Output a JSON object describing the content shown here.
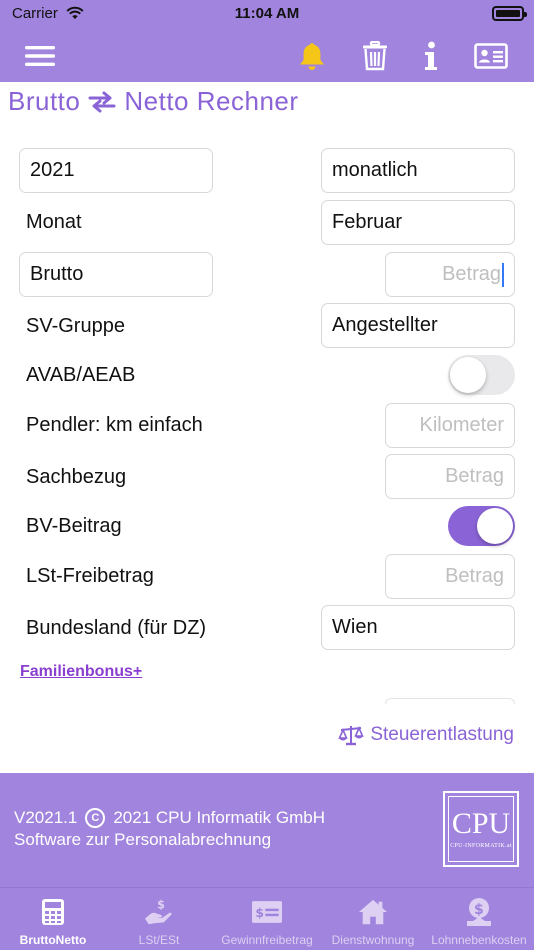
{
  "status": {
    "carrier": "Carrier",
    "time": "11:04 AM"
  },
  "title": {
    "left": "Brutto",
    "right": "Netto Rechner"
  },
  "form": {
    "year": "2021",
    "period": "monatlich",
    "month_label": "Monat",
    "month_value": "Februar",
    "type": "Brutto",
    "amount_placeholder": "Betrag",
    "sv_label": "SV-Gruppe",
    "sv_value": "Angestellter",
    "avab_label": "AVAB/AEAB",
    "avab_on": false,
    "pendler_label": "Pendler: km einfach",
    "pendler_placeholder": "Kilometer",
    "sachbezug_label": "Sachbezug",
    "sachbezug_placeholder": "Betrag",
    "bv_label": "BV-Beitrag",
    "bv_on": true,
    "lst_label": "LSt-Freibetrag",
    "lst_placeholder": "Betrag",
    "bundesland_label": "Bundesland (für DZ)",
    "bundesland_value": "Wien",
    "familienbonus_link": "Familienbonus+",
    "steuerentlastung_link": "Steuerentlastung"
  },
  "footer": {
    "version": "V2021.1",
    "copyright": "2021 CPU Informatik GmbH",
    "tagline": "Software zur Personalabrechnung",
    "logo_big": "CPU",
    "logo_small": "CPU-INFORMATIK.at"
  },
  "tabs": [
    {
      "label": "BruttoNetto",
      "icon": "calculator-icon",
      "active": true
    },
    {
      "label": "LSt/ESt",
      "icon": "hand-dollar-icon",
      "active": false
    },
    {
      "label": "Gewinnfreibetrag",
      "icon": "cash-note-icon",
      "active": false
    },
    {
      "label": "Dienstwohnung",
      "icon": "house-icon",
      "active": false
    },
    {
      "label": "Lohnnebenkosten",
      "icon": "coin-bag-icon",
      "active": false
    }
  ],
  "colors": {
    "accent": "#a184dd",
    "title": "#8a64d6",
    "link": "#8a3fd0",
    "bell": "#f5c518"
  }
}
